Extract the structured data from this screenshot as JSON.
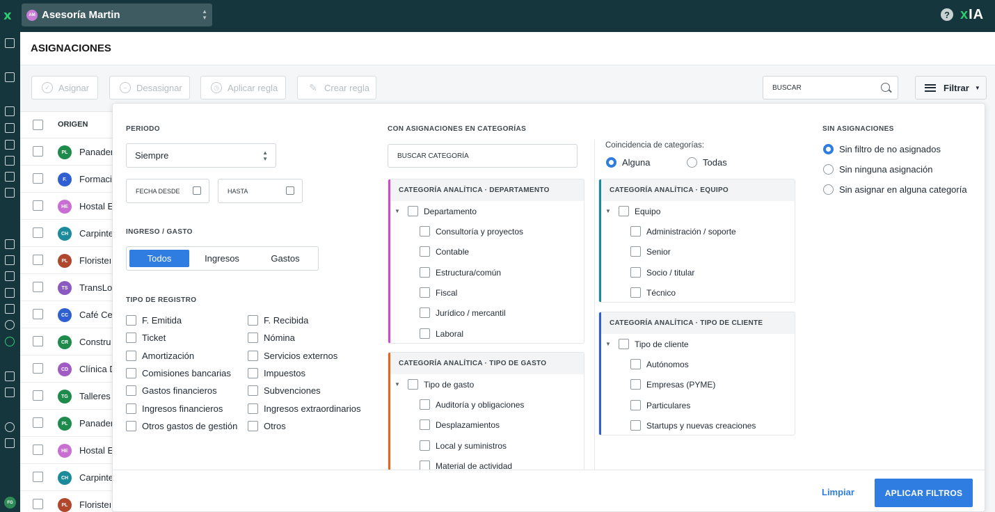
{
  "topbar": {
    "company_initials": "AM",
    "company_name": "Asesoría Martin",
    "help": "?",
    "brand_x": "x",
    "brand_ia": "IA"
  },
  "user_initials": "FG",
  "page": {
    "title": "ASIGNACIONES"
  },
  "toolbar": {
    "assign": "Asignar",
    "unassign": "Desasignar",
    "apply_rule": "Aplicar regla",
    "create_rule": "Crear regla",
    "search": "BUSCAR",
    "filter": "Filtrar"
  },
  "table": {
    "origin_header": "ORIGEN",
    "rows": [
      {
        "initials": "PL",
        "name": "Panader",
        "color": "#1e8a4c"
      },
      {
        "initials": "F.",
        "name": "Formaci",
        "color": "#2f5fd0"
      },
      {
        "initials": "HE",
        "name": "Hostal E",
        "color": "#c96fd3"
      },
      {
        "initials": "CH",
        "name": "Carpinte",
        "color": "#1b8a9a"
      },
      {
        "initials": "PL",
        "name": "Floristeı",
        "color": "#b0462c"
      },
      {
        "initials": "TS",
        "name": "TransLo",
        "color": "#8a5ac0"
      },
      {
        "initials": "CC",
        "name": "Café Cer",
        "color": "#2f5fd0"
      },
      {
        "initials": "CR",
        "name": "Constru",
        "color": "#1e8a4c"
      },
      {
        "initials": "CD",
        "name": "Clínica D",
        "color": "#a15cc4"
      },
      {
        "initials": "TG",
        "name": "Talleres",
        "color": "#1e8a4c"
      },
      {
        "initials": "PL",
        "name": "Panader",
        "color": "#1e8a4c"
      },
      {
        "initials": "HE",
        "name": "Hostal E",
        "color": "#c96fd3"
      },
      {
        "initials": "CH",
        "name": "Carpinte",
        "color": "#1b8a9a"
      },
      {
        "initials": "PL",
        "name": "Floristeı",
        "color": "#b0462c"
      }
    ]
  },
  "filters": {
    "period": {
      "label": "PERIODO",
      "value": "Siempre",
      "from": "FECHA DESDE",
      "to": "HASTA"
    },
    "income_expense": {
      "label": "INGRESO / GASTO",
      "options": [
        "Todos",
        "Ingresos",
        "Gastos"
      ],
      "selected": "Todos"
    },
    "record_type": {
      "label": "TIPO DE REGISTRO",
      "col1": [
        "F. Emitida",
        "Ticket",
        "Amortización",
        "Comisiones bancarias",
        "Gastos financieros",
        "Ingresos financieros",
        "Otros gastos de gestión"
      ],
      "col2": [
        "F. Recibida",
        "Nómina",
        "Servicios externos",
        "Impuestos",
        "Subvenciones",
        "Ingresos extraordinarios",
        "Otros"
      ]
    },
    "categories": {
      "label": "CON ASIGNACIONES EN CATEGORÍAS",
      "search": "BUSCAR CATEGORÍA",
      "match_label": "Coincidencia de categorías:",
      "match_options": [
        "Alguna",
        "Todas"
      ],
      "match_selected": "Alguna",
      "groups": [
        {
          "title": "CATEGORÍA ANALÍTICA · DEPARTAMENTO",
          "parent": "Departamento",
          "items": [
            "Consultoría y proyectos",
            "Contable",
            "Estructura/común",
            "Fiscal",
            "Jurídico / mercantil",
            "Laboral"
          ],
          "color": "#c94fc9"
        },
        {
          "title": "CATEGORÍA ANALÍTICA · TIPO DE GASTO",
          "parent": "Tipo de gasto",
          "items": [
            "Auditoría y obligaciones",
            "Desplazamientos",
            "Local y suministros",
            "Material de actividad"
          ],
          "color": "#e0691f"
        },
        {
          "title": "CATEGORÍA ANALÍTICA · EQUIPO",
          "parent": "Equipo",
          "items": [
            "Administración / soporte",
            "Senior",
            "Socio / titular",
            "Técnico"
          ],
          "color": "#1b8a9a"
        },
        {
          "title": "CATEGORÍA ANALÍTICA · TIPO DE CLIENTE",
          "parent": "Tipo de cliente",
          "items": [
            "Autónomos",
            "Empresas (PYME)",
            "Particulares",
            "Startups y nuevas creaciones"
          ],
          "color": "#2f5fd0"
        }
      ]
    },
    "unassigned": {
      "label": "SIN ASIGNACIONES",
      "options": [
        "Sin filtro de no asignados",
        "Sin ninguna asignación",
        "Sin asignar en alguna categoría"
      ],
      "selected": "Sin filtro de no asignados"
    },
    "clear": "Limpiar",
    "apply": "APLICAR FILTROS"
  }
}
